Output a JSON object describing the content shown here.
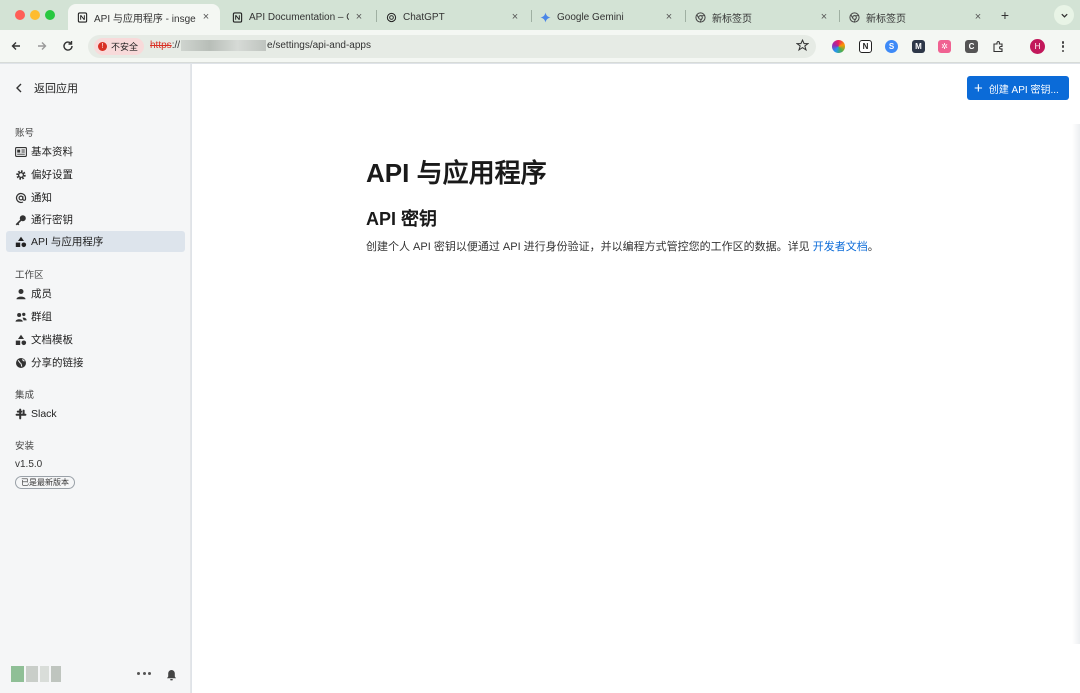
{
  "browser": {
    "tabs": [
      {
        "title": "API 与应用程序 - insgeek",
        "icon": "notion-icon",
        "active": true
      },
      {
        "title": "API Documentation – Ou",
        "icon": "notion-icon",
        "active": false
      },
      {
        "title": "ChatGPT",
        "icon": "chatgpt-icon",
        "active": false
      },
      {
        "title": "Google Gemini",
        "icon": "gemini-icon",
        "active": false
      },
      {
        "title": "新标签页",
        "icon": "chrome-icon",
        "active": false
      },
      {
        "title": "新标签页",
        "icon": "chrome-icon",
        "active": false
      }
    ],
    "close_glyph": "×",
    "new_tab_glyph": "+",
    "security_label": "不安全",
    "url_scheme": "https",
    "url_path": "e/settings/api-and-apps",
    "profile_initial": "H"
  },
  "sidebar": {
    "back_label": "返回应用",
    "sections": [
      {
        "label": "账号",
        "items": [
          {
            "label": "基本资料",
            "icon": "id-card-icon"
          },
          {
            "label": "偏好设置",
            "icon": "gear-icon"
          },
          {
            "label": "通知",
            "icon": "at-icon"
          },
          {
            "label": "通行密钥",
            "icon": "key-icon"
          },
          {
            "label": "API 与应用程序",
            "icon": "shapes-icon",
            "active": true
          }
        ]
      },
      {
        "label": "工作区",
        "items": [
          {
            "label": "成员",
            "icon": "user-icon"
          },
          {
            "label": "群组",
            "icon": "users-icon"
          },
          {
            "label": "文档模板",
            "icon": "shapes-icon"
          },
          {
            "label": "分享的链接",
            "icon": "globe-icon"
          }
        ]
      },
      {
        "label": "集成",
        "items": [
          {
            "label": "Slack",
            "icon": "slack-icon"
          }
        ]
      },
      {
        "label": "安装",
        "items": []
      }
    ],
    "version": "v1.5.0",
    "latest_badge": "已是最新版本"
  },
  "main": {
    "create_button": "创建 API 密钥...",
    "page_title": "API 与应用程序",
    "section_title": "API 密钥",
    "description": "创建个人 API 密钥以便通过 API 进行身份验证，并以编程方式管控您的工作区的数据。详见 ",
    "link_text": "开发者文档",
    "description_end": "。"
  },
  "colors": {
    "accent": "#0b6bd8",
    "sidebar_bg": "#f5f6f7",
    "active_item_bg": "#dde4ec",
    "tabbar_bg": "#d3e3d5",
    "insecure_red": "#d93025"
  }
}
